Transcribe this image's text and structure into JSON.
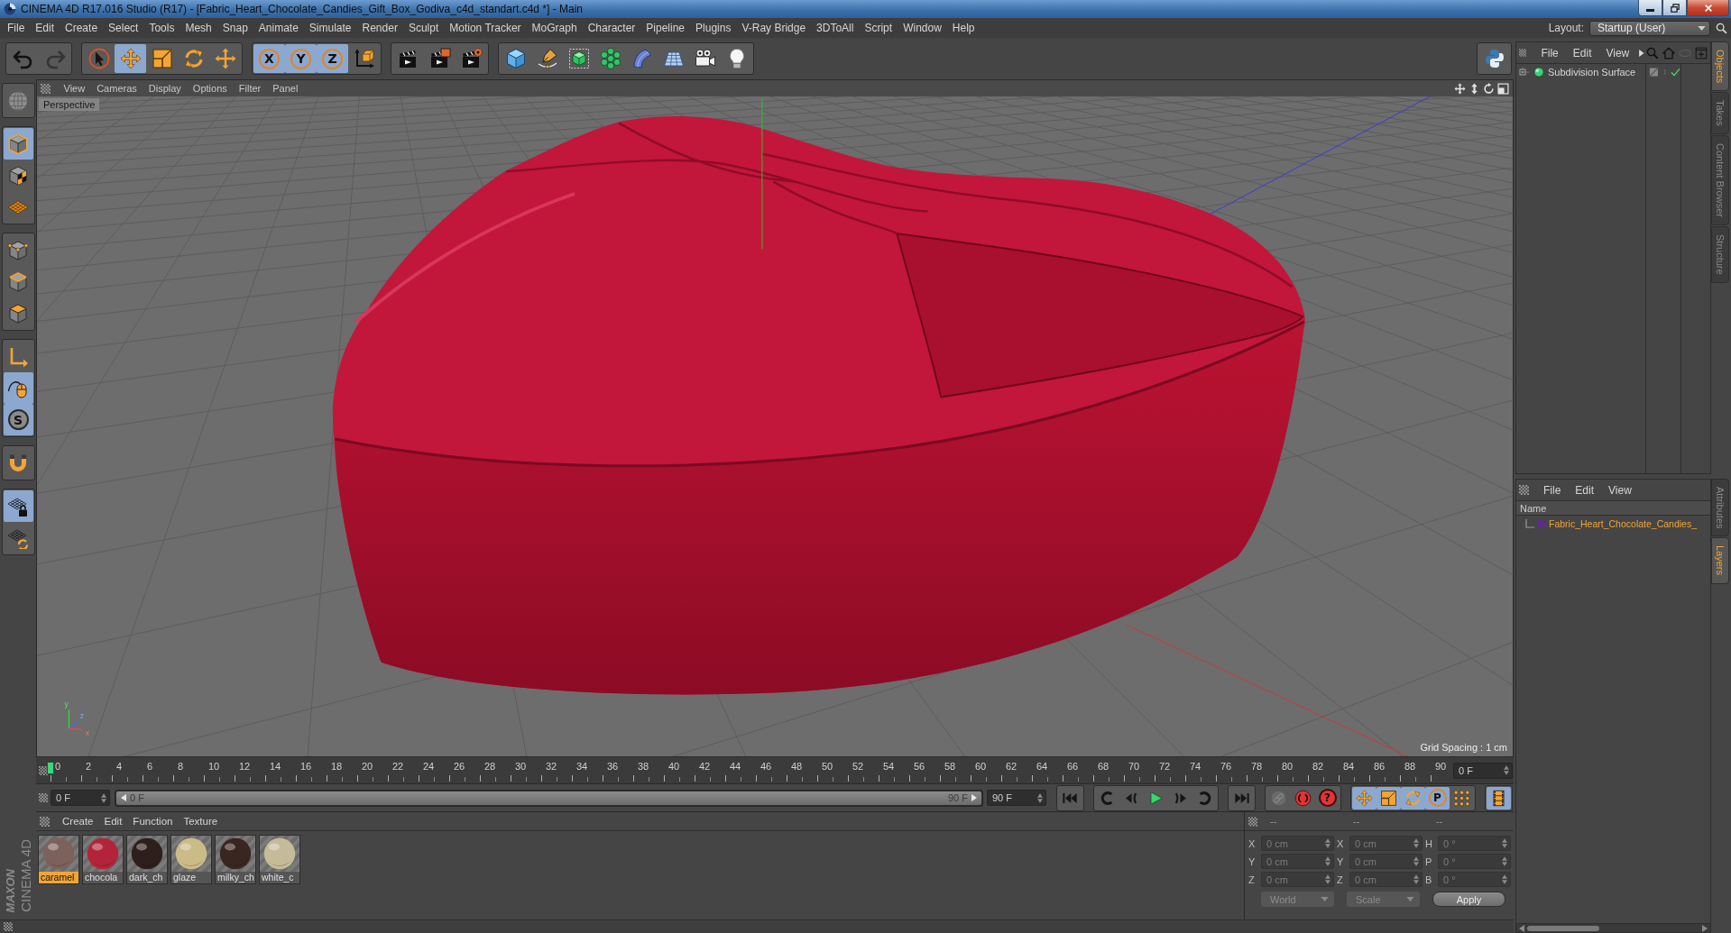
{
  "window": {
    "title": "CINEMA 4D R17.016 Studio (R17) - [Fabric_Heart_Chocolate_Candies_Gift_Box_Godiva_c4d_standart.c4d *] - Main"
  },
  "menu": [
    "File",
    "Edit",
    "Create",
    "Select",
    "Tools",
    "Mesh",
    "Snap",
    "Animate",
    "Simulate",
    "Render",
    "Sculpt",
    "Motion Tracker",
    "MoGraph",
    "Character",
    "Pipeline",
    "Plugins",
    "V-Ray Bridge",
    "3DToAll",
    "Script",
    "Window",
    "Help"
  ],
  "layout": {
    "label": "Layout:",
    "value": "Startup (User)"
  },
  "toolbar": [
    [
      {
        "kind": "undo",
        "selected": false,
        "disabled": false
      },
      {
        "kind": "redo",
        "selected": false,
        "disabled": true
      }
    ],
    [
      {
        "kind": "select",
        "selected": false,
        "disabled": false
      },
      {
        "kind": "move",
        "selected": true,
        "disabled": false
      },
      {
        "kind": "scale",
        "selected": false,
        "disabled": false
      },
      {
        "kind": "rotate",
        "selected": false,
        "disabled": false
      },
      {
        "kind": "transform",
        "selected": false,
        "disabled": false
      }
    ],
    [
      {
        "kind": "axis",
        "label": "X",
        "selected": true,
        "disabled": false
      },
      {
        "kind": "axis",
        "label": "Y",
        "selected": true,
        "disabled": false
      },
      {
        "kind": "axis",
        "label": "Z",
        "selected": true,
        "disabled": false
      },
      {
        "kind": "coordinates",
        "selected": false,
        "disabled": false
      }
    ],
    [
      {
        "kind": "renderview",
        "selected": false,
        "disabled": false
      },
      {
        "kind": "renderpicture",
        "selected": false,
        "disabled": false
      },
      {
        "kind": "rendersettings",
        "selected": false,
        "disabled": false
      }
    ],
    [
      {
        "kind": "cube",
        "selected": false,
        "disabled": false
      },
      {
        "kind": "pen",
        "selected": false,
        "disabled": false
      },
      {
        "kind": "subdivision",
        "selected": false,
        "disabled": false
      },
      {
        "kind": "cloner",
        "selected": false,
        "disabled": false
      },
      {
        "kind": "deformer",
        "selected": false,
        "disabled": false
      },
      {
        "kind": "floor",
        "selected": false,
        "disabled": false
      },
      {
        "kind": "camera",
        "selected": false,
        "disabled": false
      },
      {
        "kind": "light",
        "selected": false,
        "disabled": false
      }
    ],
    [
      {
        "kind": "python",
        "selected": false,
        "disabled": false
      }
    ]
  ],
  "side_toolbar": [
    [
      {
        "kind": "editable",
        "selected": false
      }
    ],
    [
      {
        "kind": "model",
        "selected": true
      },
      {
        "kind": "texture",
        "selected": false
      },
      {
        "kind": "workplane",
        "selected": false
      }
    ],
    [
      {
        "kind": "points",
        "selected": false
      },
      {
        "kind": "edges",
        "selected": false
      },
      {
        "kind": "polygons",
        "selected": false
      }
    ],
    [
      {
        "kind": "axismode",
        "selected": false
      },
      {
        "kind": "tweak",
        "selected": true
      },
      {
        "kind": "solo",
        "label": "S",
        "selected": true
      }
    ],
    [
      {
        "kind": "snap",
        "selected": false
      }
    ],
    [
      {
        "kind": "lockplane",
        "selected": true
      },
      {
        "kind": "planerotate",
        "selected": false
      }
    ]
  ],
  "logo": {
    "brand": "MAXON",
    "product": "CINEMA 4D"
  },
  "viewport": {
    "menu": [
      "View",
      "Cameras",
      "Display",
      "Options",
      "Filter",
      "Panel"
    ],
    "camera": "Perspective",
    "grid_spacing": "Grid Spacing : 1 cm",
    "gizmo_labels": [
      "y",
      "z",
      "x"
    ]
  },
  "timeline": {
    "ticks": [
      "0",
      "2",
      "4",
      "6",
      "8",
      "10",
      "12",
      "14",
      "16",
      "18",
      "20",
      "22",
      "24",
      "26",
      "28",
      "30",
      "32",
      "34",
      "36",
      "38",
      "40",
      "42",
      "44",
      "46",
      "48",
      "50",
      "52",
      "54",
      "56",
      "58",
      "60",
      "62",
      "64",
      "66",
      "68",
      "70",
      "72",
      "74",
      "76",
      "78",
      "80",
      "82",
      "84",
      "86",
      "88",
      "90"
    ],
    "playhead": {
      "level": 0
    },
    "frame": "0 F"
  },
  "playback": {
    "start": "0 F",
    "range": {
      "start": "0 F",
      "end": "90 F",
      "level": 1
    },
    "end": "90 F",
    "buttons": [
      [
        {
          "kind": "first",
          "selected": false,
          "disabled": false
        }
      ],
      [
        {
          "kind": "prevkey",
          "selected": false,
          "disabled": false
        },
        {
          "kind": "prevframe",
          "selected": false,
          "disabled": false
        },
        {
          "kind": "play",
          "selected": false,
          "disabled": false
        },
        {
          "kind": "nextframe",
          "selected": false,
          "disabled": false
        },
        {
          "kind": "nextkey",
          "selected": false,
          "disabled": false
        }
      ],
      [
        {
          "kind": "last",
          "selected": false,
          "disabled": false
        }
      ],
      [
        {
          "kind": "keylink",
          "selected": false,
          "disabled": true
        },
        {
          "kind": "record",
          "selected": false,
          "disabled": false
        },
        {
          "kind": "keyselect",
          "label": "?",
          "selected": false,
          "disabled": false
        }
      ],
      [
        {
          "kind": "move",
          "selected": true,
          "disabled": false
        },
        {
          "kind": "scale",
          "selected": true,
          "disabled": false
        },
        {
          "kind": "rotate",
          "selected": true,
          "disabled": false
        },
        {
          "kind": "param",
          "label": "P",
          "selected": true,
          "disabled": false
        },
        {
          "kind": "keydots",
          "selected": false,
          "disabled": false
        }
      ],
      [
        {
          "kind": "timeline",
          "selected": true,
          "disabled": false
        }
      ]
    ]
  },
  "materials": {
    "menu": [
      "Create",
      "Edit",
      "Function",
      "Texture"
    ],
    "items": [
      {
        "name": "caramel",
        "selected": true,
        "color": "#7d625b"
      },
      {
        "name": "chocola",
        "selected": false,
        "color": "#b3243a"
      },
      {
        "name": "dark_ch",
        "selected": false,
        "color": "#2e1f1c"
      },
      {
        "name": "glaze",
        "selected": false,
        "color": "#cbbb86"
      },
      {
        "name": "milky_ch",
        "selected": false,
        "color": "#3a2620"
      },
      {
        "name": "white_c",
        "selected": false,
        "color": "#c6bb98"
      }
    ]
  },
  "coordinates": {
    "headers": [
      "--",
      "--",
      "--"
    ],
    "columns": [
      [
        {
          "axis": "X",
          "value": "0 cm"
        },
        {
          "axis": "Y",
          "value": "0 cm"
        },
        {
          "axis": "Z",
          "value": "0 cm"
        }
      ],
      [
        {
          "axis": "X",
          "value": "0 cm"
        },
        {
          "axis": "Y",
          "value": "0 cm"
        },
        {
          "axis": "Z",
          "value": "0 cm"
        }
      ],
      [
        {
          "axis": "H",
          "value": "0 °"
        },
        {
          "axis": "P",
          "value": "0 °"
        },
        {
          "axis": "B",
          "value": "0 °"
        }
      ]
    ],
    "dropdowns": [
      "World",
      "Scale"
    ],
    "apply": "Apply"
  },
  "objects_panel": {
    "menu": [
      "File",
      "Edit",
      "View"
    ],
    "objects": [
      {
        "name": "Subdivision Surface",
        "enabled": true
      }
    ]
  },
  "layers_panel": {
    "menu": [
      "File",
      "Edit",
      "View"
    ],
    "column": "Name",
    "layers": [
      {
        "name": "Fabric_Heart_Chocolate_Candies_",
        "color": "#5b2e82",
        "selected": true
      }
    ]
  },
  "side_tabs": {
    "top": [
      {
        "label": "Objects",
        "selected": true
      },
      {
        "label": "Takes",
        "selected": false
      },
      {
        "label": "Content Browser",
        "selected": false
      },
      {
        "label": "Structure",
        "selected": false
      }
    ],
    "bottom": [
      {
        "label": "Attributes",
        "selected": false
      },
      {
        "label": "Layers",
        "selected": true
      }
    ]
  }
}
